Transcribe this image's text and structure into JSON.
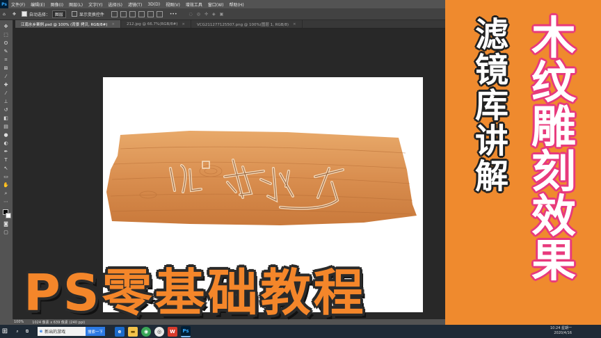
{
  "app": {
    "logo": "Ps"
  },
  "menu": [
    "文件(F)",
    "编辑(E)",
    "图像(I)",
    "图层(L)",
    "文字(Y)",
    "选择(S)",
    "滤镜(T)",
    "3D(D)",
    "视图(V)",
    "增效工具",
    "窗口(W)",
    "帮助(H)"
  ],
  "options": {
    "auto_select_label": "自动选择：",
    "auto_select_value": "图层",
    "transform_label": "显示变换控件"
  },
  "tabs": [
    {
      "label": "江南水乡案例.psd @ 100% (背景 拷贝, RGB/8#)",
      "close": "×"
    },
    {
      "label": "212.jpg @ 66.7%(RGB/8#)",
      "close": "×"
    },
    {
      "label": "VCG211277125507.png @ 100%(图层 1, RGB/8)",
      "close": "×"
    }
  ],
  "status": {
    "zoom": "100%",
    "doc_size": "1024 像素 x 639 像素 (240 ppi)"
  },
  "taskbar": {
    "start": "⊞",
    "search_text": "新出的游戏",
    "search_button": "搜索一下",
    "clock_time": "10:24 星期一",
    "clock_date": "2020/4/16"
  },
  "overlay": {
    "right_title": [
      "木",
      "纹",
      "雕",
      "刻",
      "效",
      "果"
    ],
    "left_title": [
      "滤",
      "镜",
      "库",
      "讲",
      "解"
    ],
    "bottom_title": "PS零基础教程"
  },
  "colors": {
    "accent_orange": "#ef8a2e",
    "pink_outline": "#e83a7d",
    "bottom_text": "#f4862a"
  }
}
